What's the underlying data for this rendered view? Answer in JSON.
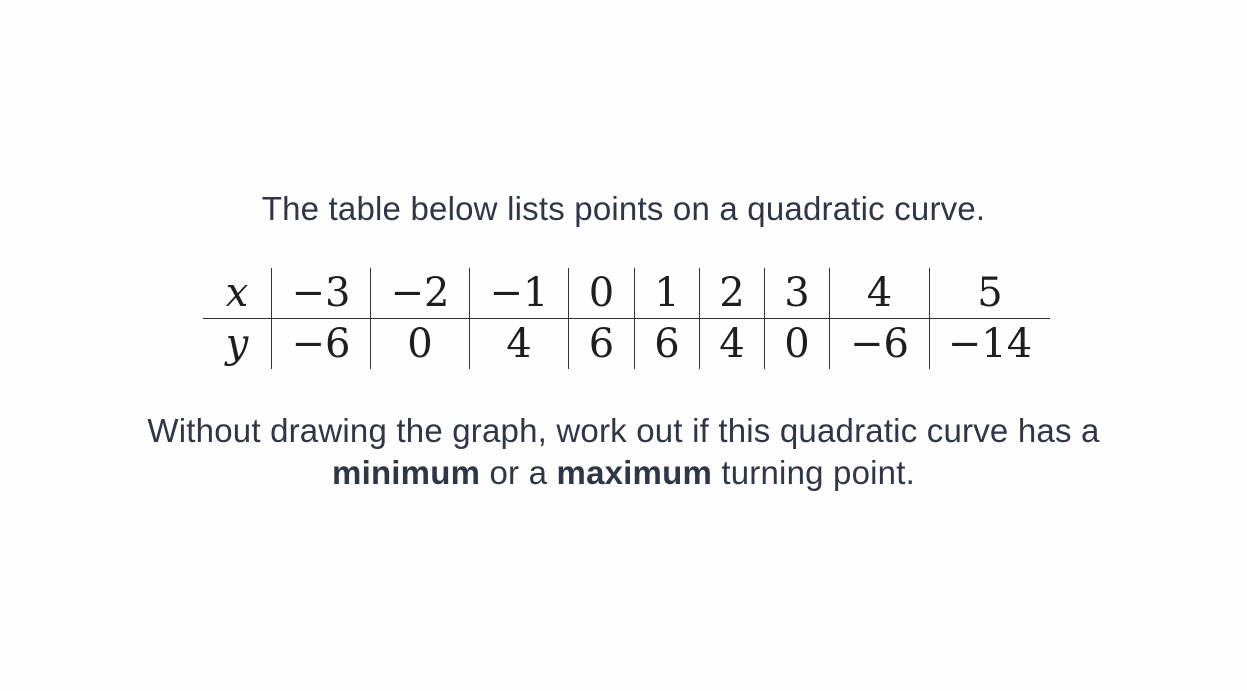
{
  "intro": "The table below lists points on a quadratic curve.",
  "table": {
    "x_label": "x",
    "y_label": "y",
    "x_values": [
      "−3",
      "−2",
      "−1",
      "0",
      "1",
      "2",
      "3",
      "4",
      "5"
    ],
    "y_values": [
      "−6",
      "0",
      "4",
      "6",
      "6",
      "4",
      "0",
      "−6",
      "−14"
    ]
  },
  "question": {
    "line1": "Without drawing the graph, work out if this quadratic curve has a",
    "term_min": "minimum",
    "connector": " or a ",
    "term_max": "maximum",
    "tail": " turning point."
  }
}
